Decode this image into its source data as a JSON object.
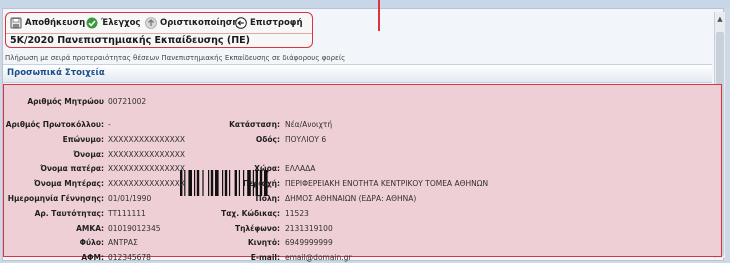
{
  "toolbar": {
    "save_label": "Αποθήκευση",
    "check_label": "Έλεγχος",
    "finalize_label": "Οριστικοποίηση",
    "return_label": "Επιστροφή"
  },
  "page_title": "5K/2020 Πανεπιστημιακής Εκπαίδευσης (ΠΕ)",
  "hint_text": "Πλήρωση με σειρά προτεραιότητας θέσεων Πανεπιστημιακής Εκπαίδευσης σε διάφορους φορείς",
  "section_title": "Προσωπικά Στοιχεία",
  "colors": {
    "accent_red": "#d9343f",
    "section_blue": "#1b4f8a",
    "panel_bg": "#eecfd5"
  },
  "registry": {
    "label": "Αριθμός Μητρώου",
    "value": "00721002"
  },
  "left_fields": [
    {
      "label": "Αριθμός Πρωτοκόλλου:",
      "value": "-"
    },
    {
      "label": "Επώνυμο:",
      "value": "XXXXXXXXXXXXXXX"
    },
    {
      "label": "Όνομα:",
      "value": "XXXXXXXXXXXXXXX"
    },
    {
      "label": "Όνομα πατέρα:",
      "value": "XXXXXXXXXXXXXXX"
    },
    {
      "label": "Όνομα Μητέρας:",
      "value": "XXXXXXXXXXXXXXX"
    },
    {
      "label": "Ημερομηνία Γέννησης:",
      "value": "01/01/1990"
    },
    {
      "label": "Αρ. Ταυτότητας:",
      "value": "ΤΤ111111"
    },
    {
      "label": "ΑΜΚΑ:",
      "value": "01019012345"
    },
    {
      "label": "Φύλο:",
      "value": "ΑΝΤΡΑΣ"
    },
    {
      "label": "ΑΦΜ:",
      "value": "012345678"
    }
  ],
  "right_fields": [
    {
      "label": "Κατάσταση:",
      "value": "Νέα/Ανοιχτή"
    },
    {
      "label": "Οδός:",
      "value": "ΠΟΥΛΙΟΥ 6"
    },
    {
      "label": "",
      "value": ""
    },
    {
      "label": "Χώρα:",
      "value": "ΕΛΛΑΔΑ"
    },
    {
      "label": "Περιοχή:",
      "value": "ΠΕΡΙΦΕΡΕΙΑΚΗ ΕΝΟΤΗΤΑ ΚΕΝΤΡΙΚΟΥ ΤΟΜΕΑ ΑΘΗΝΩΝ"
    },
    {
      "label": "Πόλη:",
      "value": "ΔΗΜΟΣ ΑΘΗΝΑΙΩΝ (ΕΔΡΑ: ΑΘΗΝΑ)"
    },
    {
      "label": "Ταχ. Κώδικας:",
      "value": "11523"
    },
    {
      "label": "Τηλέφωνο:",
      "value": "2131319100"
    },
    {
      "label": "Κινητό:",
      "value": "6949999999"
    },
    {
      "label": "E-mail:",
      "value": "email@domain.gr"
    }
  ]
}
